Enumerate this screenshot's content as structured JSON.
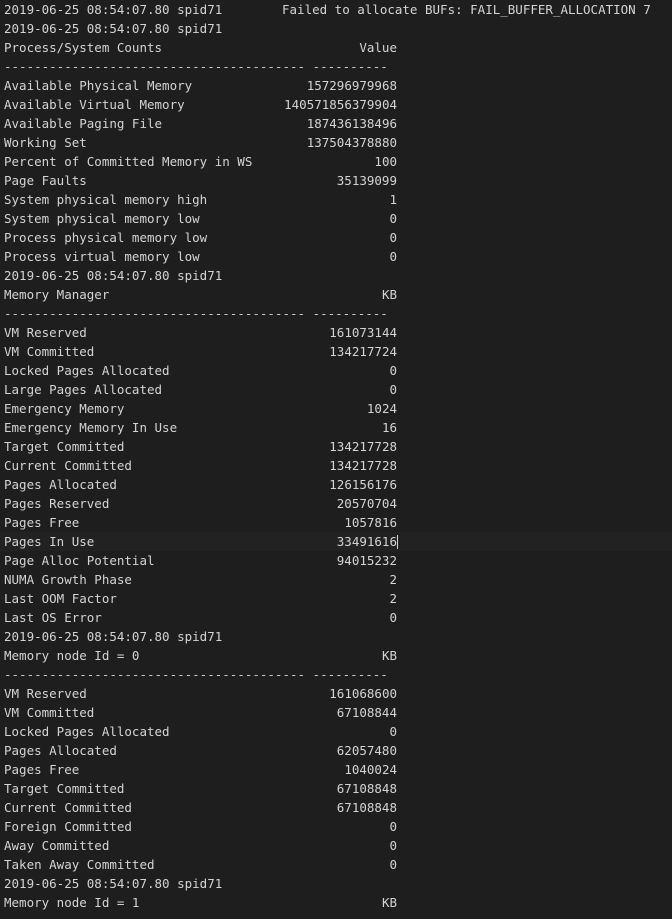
{
  "lines": [
    {
      "type": "ts",
      "text": "2019-06-25 08:54:07.80 spid71",
      "msg": "Failed to allocate BUFs: FAIL_BUFFER_ALLOCATION 7"
    },
    {
      "type": "ts",
      "text": "2019-06-25 08:54:07.80 spid71"
    },
    {
      "type": "kv",
      "label": "Process/System Counts",
      "value": "Value"
    },
    {
      "type": "sep",
      "text": "---------------------------------------- ----------"
    },
    {
      "type": "kv",
      "label": "Available Physical Memory",
      "value": "157296979968"
    },
    {
      "type": "kv",
      "label": "Available Virtual Memory",
      "value": "140571856379904"
    },
    {
      "type": "kv",
      "label": "Available Paging File",
      "value": "187436138496"
    },
    {
      "type": "kv",
      "label": "Working Set",
      "value": "137504378880"
    },
    {
      "type": "kv",
      "label": "Percent of Committed Memory in WS",
      "value": "100"
    },
    {
      "type": "kv",
      "label": "Page Faults",
      "value": "35139099"
    },
    {
      "type": "kv",
      "label": "System physical memory high",
      "value": "1"
    },
    {
      "type": "kv",
      "label": "System physical memory low",
      "value": "0"
    },
    {
      "type": "kv",
      "label": "Process physical memory low",
      "value": "0"
    },
    {
      "type": "kv",
      "label": "Process virtual memory low",
      "value": "0"
    },
    {
      "type": "ts",
      "text": "2019-06-25 08:54:07.80 spid71"
    },
    {
      "type": "kv",
      "label": "Memory Manager",
      "value": "KB"
    },
    {
      "type": "sep",
      "text": "---------------------------------------- ----------"
    },
    {
      "type": "kv",
      "label": "VM Reserved",
      "value": "161073144"
    },
    {
      "type": "kv",
      "label": "VM Committed",
      "value": "134217724"
    },
    {
      "type": "kv",
      "label": "Locked Pages Allocated",
      "value": "0"
    },
    {
      "type": "kv",
      "label": "Large Pages Allocated",
      "value": "0"
    },
    {
      "type": "kv",
      "label": "Emergency Memory",
      "value": "1024"
    },
    {
      "type": "kv",
      "label": "Emergency Memory In Use",
      "value": "16"
    },
    {
      "type": "kv",
      "label": "Target Committed",
      "value": "134217728"
    },
    {
      "type": "kv",
      "label": "Current Committed",
      "value": "134217728"
    },
    {
      "type": "kv",
      "label": "Pages Allocated",
      "value": "126156176"
    },
    {
      "type": "kv",
      "label": "Pages Reserved",
      "value": "20570704"
    },
    {
      "type": "kv",
      "label": "Pages Free",
      "value": "1057816"
    },
    {
      "type": "kv",
      "label": "Pages In Use",
      "value": "33491616",
      "current": true
    },
    {
      "type": "kv",
      "label": "Page Alloc Potential",
      "value": "94015232"
    },
    {
      "type": "kv",
      "label": "NUMA Growth Phase",
      "value": "2"
    },
    {
      "type": "kv",
      "label": "Last OOM Factor",
      "value": "2"
    },
    {
      "type": "kv",
      "label": "Last OS Error",
      "value": "0"
    },
    {
      "type": "ts",
      "text": "2019-06-25 08:54:07.80 spid71"
    },
    {
      "type": "kv",
      "label": "Memory node Id = 0",
      "value": "KB"
    },
    {
      "type": "sep",
      "text": "---------------------------------------- ----------"
    },
    {
      "type": "kv",
      "label": "VM Reserved",
      "value": "161068600"
    },
    {
      "type": "kv",
      "label": "VM Committed",
      "value": "67108844"
    },
    {
      "type": "kv",
      "label": "Locked Pages Allocated",
      "value": "0"
    },
    {
      "type": "kv",
      "label": "Pages Allocated",
      "value": "62057480"
    },
    {
      "type": "kv",
      "label": "Pages Free",
      "value": "1040024"
    },
    {
      "type": "kv",
      "label": "Target Committed",
      "value": "67108848"
    },
    {
      "type": "kv",
      "label": "Current Committed",
      "value": "67108848"
    },
    {
      "type": "kv",
      "label": "Foreign Committed",
      "value": "0"
    },
    {
      "type": "kv",
      "label": "Away Committed",
      "value": "0"
    },
    {
      "type": "kv",
      "label": "Taken Away Committed",
      "value": "0"
    },
    {
      "type": "ts",
      "text": "2019-06-25 08:54:07.80 spid71"
    },
    {
      "type": "kv",
      "label": "Memory node Id = 1",
      "value": "KB"
    }
  ]
}
